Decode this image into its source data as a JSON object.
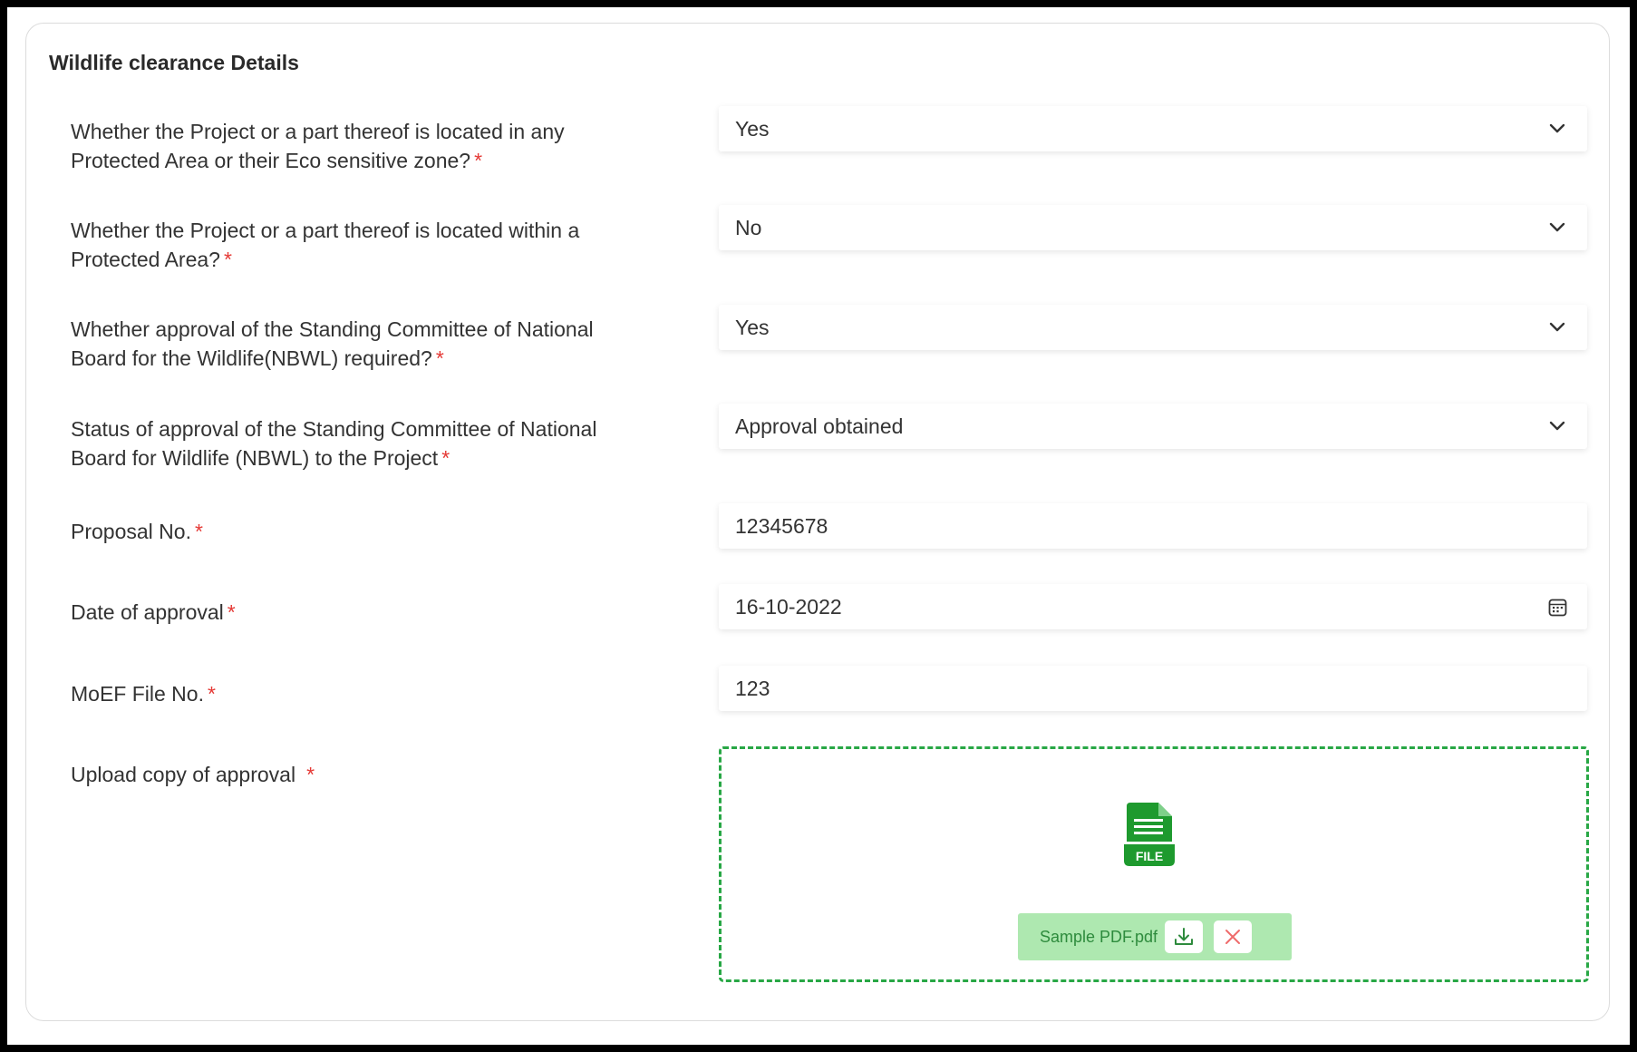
{
  "section": {
    "title": "Wildlife clearance Details"
  },
  "required_mark": "*",
  "fields": {
    "protected_area_or_esz": {
      "label": "Whether the Project or a part thereof is located in any Protected Area or their Eco sensitive zone?",
      "value": "Yes",
      "icon": "chevron-down-icon"
    },
    "within_protected_area": {
      "label": "Whether the Project or a part thereof is located within a Protected Area?",
      "value": "No",
      "icon": "chevron-down-icon"
    },
    "nbwl_required": {
      "label": "Whether approval of the Standing Committee of National Board for the Wildlife(NBWL) required?",
      "value": "Yes",
      "icon": "chevron-down-icon"
    },
    "nbwl_status": {
      "label": "Status of approval of the Standing Committee of National Board for Wildlife (NBWL) to the Project",
      "value": "Approval obtained",
      "icon": "chevron-down-icon"
    },
    "proposal_no": {
      "label": "Proposal No.",
      "value": "12345678"
    },
    "date_of_approval": {
      "label": "Date of approval",
      "value": "16-10-2022",
      "icon": "calendar-icon"
    },
    "moef_file_no": {
      "label": "MoEF File No.",
      "value": "123"
    },
    "upload": {
      "label": "Upload copy of approval",
      "file_icon_text": "FILE",
      "file_name": "Sample PDF.pdf",
      "download_icon": "download-icon",
      "remove_icon": "close-icon"
    }
  },
  "colors": {
    "accent_green": "#28a745",
    "file_icon_green": "#1e9a2e",
    "chip_background": "#aee8b0",
    "required_red": "#e53935"
  }
}
